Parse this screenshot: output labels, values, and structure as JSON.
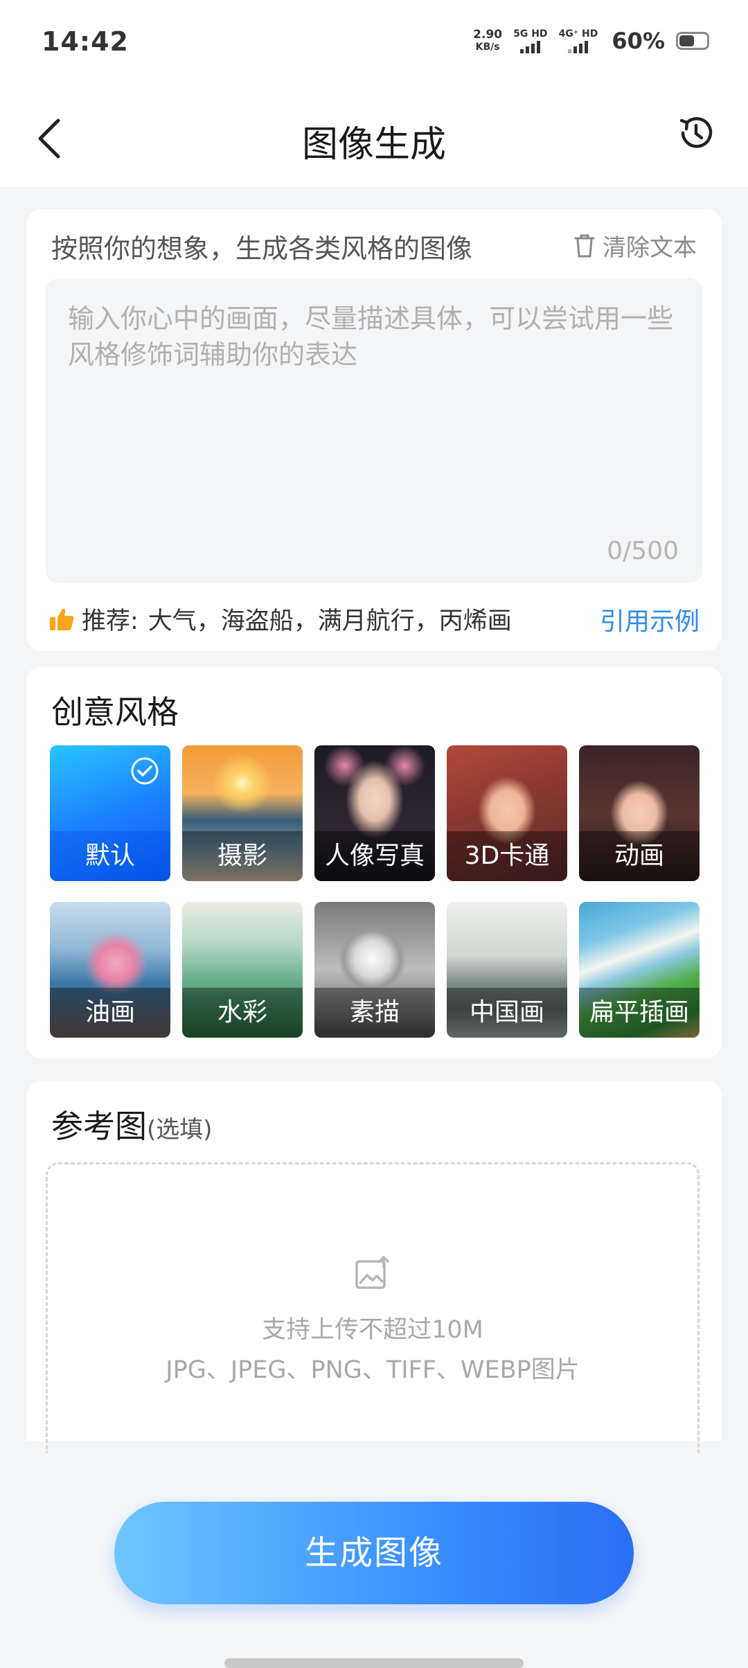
{
  "status_bar": {
    "time": "14:42",
    "net_speed_value": "2.90",
    "net_speed_unit": "KB/s",
    "sim1_label": "5G HD",
    "sim2_label": "4G⁺ HD",
    "battery_percent": "60%",
    "battery_level": 0.6
  },
  "header": {
    "title": "图像生成",
    "back_icon": "chevron-left-icon",
    "history_icon": "history-clock-icon"
  },
  "prompt_card": {
    "title": "按照你的想象，生成各类风格的图像",
    "clear_label": "清除文本",
    "placeholder": "输入你心中的画面，尽量描述具体，可以尝试用一些风格修饰词辅助你的表达",
    "char_count": "0/500",
    "recommend_label": "推荐:",
    "recommend_text": "大气，海盗船，满月航行，丙烯画",
    "cite_label": "引用示例"
  },
  "style_card": {
    "title": "创意风格",
    "selected_index": 0,
    "styles": [
      {
        "label": "默认"
      },
      {
        "label": "摄影"
      },
      {
        "label": "人像写真"
      },
      {
        "label": "3D卡通"
      },
      {
        "label": "动画"
      },
      {
        "label": "油画"
      },
      {
        "label": "水彩"
      },
      {
        "label": "素描"
      },
      {
        "label": "中国画"
      },
      {
        "label": "扁平插画"
      }
    ]
  },
  "reference_card": {
    "title": "参考图",
    "optional": "(选填)",
    "upload_line1": "支持上传不超过10M",
    "upload_line2": "JPG、JPEG、PNG、TIFF、WEBP图片"
  },
  "generate_button": {
    "label": "生成图像"
  },
  "colors": {
    "accent": "#2d8cf0",
    "button_start": "#6fc6ff",
    "button_end": "#2a6ff5"
  }
}
